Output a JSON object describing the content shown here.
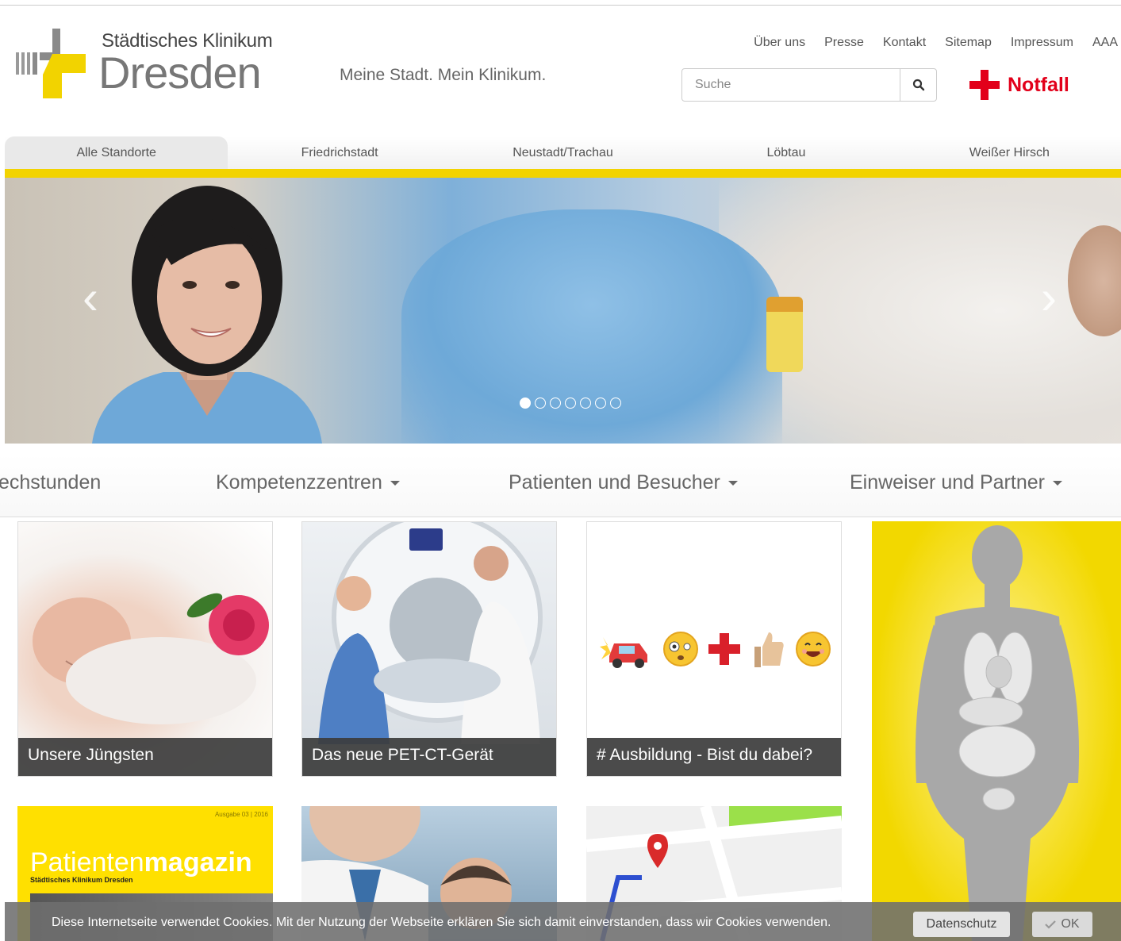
{
  "logo": {
    "line1": "Städtisches Klinikum",
    "line2": "Dresden"
  },
  "slogan": "Meine Stadt. Mein Klinikum.",
  "meta_nav": [
    "Über uns",
    "Presse",
    "Kontakt",
    "Sitemap",
    "Impressum",
    "AAA"
  ],
  "search": {
    "placeholder": "Suche",
    "icon": "search-icon"
  },
  "emergency": {
    "label": "Notfall",
    "color": "#e2001a"
  },
  "location_tabs": [
    "Alle Standorte",
    "Friedrichstadt",
    "Neustadt/Trachau",
    "Löbtau",
    "Weißer Hirsch"
  ],
  "accent_color": "#f2d300",
  "slider": {
    "dots_total": 7,
    "active_index": 0
  },
  "main_nav": [
    "echstunden",
    "Kompetenzzentren",
    "Patienten und Besucher",
    "Einweiser und Partner"
  ],
  "tiles": [
    {
      "caption": "Unsere Jüngsten"
    },
    {
      "caption": "Das neue PET-CT-Gerät"
    },
    {
      "caption": "# Ausbildung - Bist du dabei?"
    }
  ],
  "magazine": {
    "title_light": "Patienten",
    "title_bold": "magazin",
    "subtitle": "Städtisches Klinikum Dresden",
    "issue": "Ausgabe 03 | 2016"
  },
  "cookie": {
    "text": "Diese Internetseite verwendet Cookies. Mit der Nutzung der Webseite erklären Sie sich damit einverstanden, dass wir Cookies verwenden.",
    "privacy_label": "Datenschutz",
    "ok_label": "OK"
  }
}
